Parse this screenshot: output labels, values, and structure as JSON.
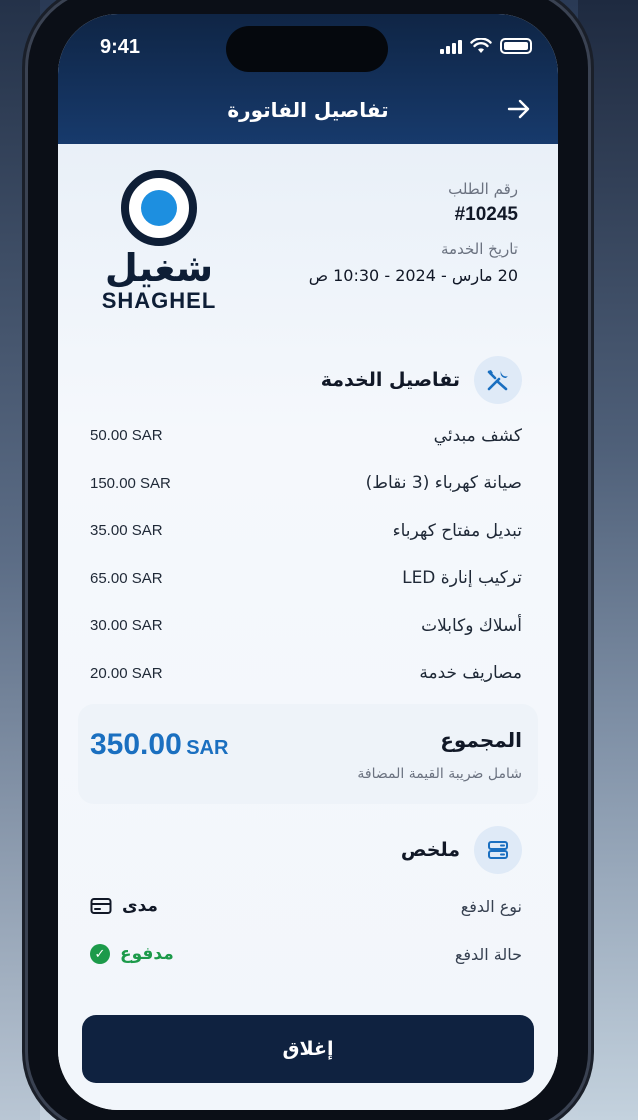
{
  "status_bar": {
    "time": "9:41"
  },
  "nav": {
    "title": "تفاصيل الفاتورة",
    "back_icon": "arrow-right-icon"
  },
  "order": {
    "number_label": "رقم الطلب",
    "number": "#10245",
    "date_label": "تاريخ الخدمة",
    "date": "20 مارس - 2024 - 10:30 ص"
  },
  "logo": {
    "arabic": "شغيل",
    "english": "SHAGHEL"
  },
  "service_section": {
    "title": "تفاصيل الخدمة",
    "icon": "tools-icon"
  },
  "line_items": [
    {
      "name": "كشف مبدئي",
      "price": "50.00 SAR"
    },
    {
      "name": "صيانة كهرباء (3 نقاط)",
      "price": "150.00 SAR"
    },
    {
      "name": "تبديل مفتاح كهرباء",
      "price": "35.00 SAR"
    },
    {
      "name": "تركيب إنارة LED",
      "price": "65.00 SAR"
    },
    {
      "name": "أسلاك وكابلات",
      "price": "30.00 SAR"
    },
    {
      "name": "مصاريف خدمة",
      "price": "20.00 SAR"
    }
  ],
  "total": {
    "label": "المجموع",
    "note": "شامل ضريبة القيمة المضافة",
    "amount": "350.00",
    "currency": "SAR",
    "color": "#1a6fc0"
  },
  "summary_section": {
    "title": "ملخص",
    "icon": "receipt-icon"
  },
  "summary": {
    "payment_type_label": "نوع الدفع",
    "payment_type": "مدى",
    "payment_status_label": "حالة الدفع",
    "payment_status": "مدفوع",
    "status_color": "#1c9a4a"
  },
  "actions": {
    "close_label": "إغلاق"
  }
}
